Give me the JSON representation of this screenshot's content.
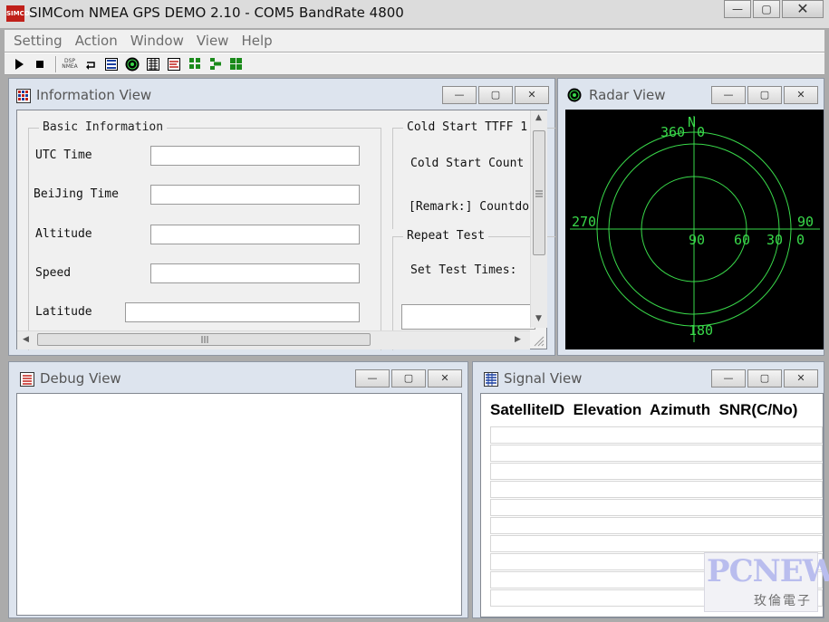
{
  "app": {
    "title": "SIMCom NMEA GPS DEMO 2.10 - COM5 BandRate 4800",
    "icon_text": "SIMCOM",
    "window_buttons": {
      "minimize": "—",
      "maximize": "▢",
      "close": "✕"
    }
  },
  "menu": [
    "Setting",
    "Action",
    "Window",
    "View",
    "Help"
  ],
  "toolbar": {
    "buttons": [
      "play-icon",
      "stop-icon",
      "dsp-nmea-icon",
      "reset-icon",
      "info-view-icon",
      "radar-view-icon",
      "debug-view-icon",
      "signal-view-icon",
      "layout-grid-icon",
      "layout-tree-icon",
      "layout-tile-icon"
    ],
    "dsp_label_top": "DSP",
    "dsp_label_bottom": "NMEA"
  },
  "info_view": {
    "title": "Information View",
    "basic_group": "Basic Information",
    "fields": [
      {
        "label": "UTC Time",
        "value": ""
      },
      {
        "label": "BeiJing Time",
        "value": ""
      },
      {
        "label": "Altitude",
        "value": ""
      },
      {
        "label": "Speed",
        "value": ""
      },
      {
        "label": "Latitude",
        "value": ""
      }
    ],
    "right_panel": {
      "cold_start_group": "Cold Start TTFF 1",
      "cold_start_count": "Cold Start Count",
      "remark": "[Remark:] Countdo",
      "repeat_group": "Repeat Test",
      "set_test_times": "Set Test Times:"
    }
  },
  "radar_view": {
    "title": "Radar View",
    "north": "N",
    "labels": {
      "top_360": "360",
      "top_0": "0",
      "left": "270",
      "right_90": "90",
      "right_0": "0",
      "bottom": "180",
      "ring_90": "90",
      "ring_60": "60",
      "ring_30": "30"
    },
    "colors": {
      "background": "#000000",
      "grid": "#39d94a"
    }
  },
  "debug_view": {
    "title": "Debug View"
  },
  "signal_view": {
    "title": "Signal View",
    "header": "SatelliteID  Elevation  Azimuth  SNR(C/No)",
    "rows": 10
  },
  "watermark": {
    "main": "PCNEWS",
    "sub": "玫倫電子"
  }
}
